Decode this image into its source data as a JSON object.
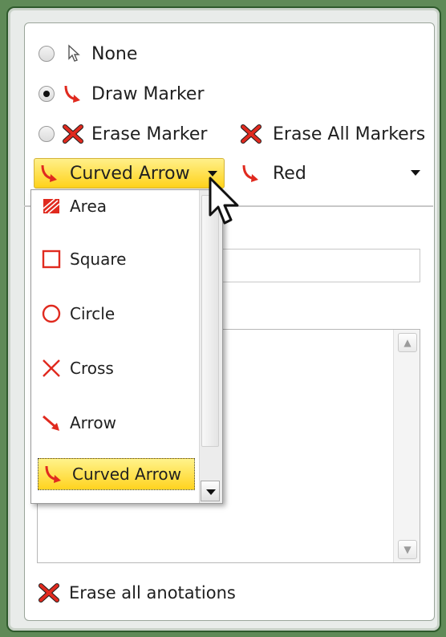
{
  "options": {
    "none_label": "None",
    "draw_marker_label": "Draw Marker",
    "erase_marker_label": "Erase Marker",
    "erase_all_markers_label": "Erase All Markers",
    "selected_mode": "Draw Marker"
  },
  "shape_select": {
    "value": "Curved Arrow",
    "items": [
      "Area",
      "Square",
      "Circle",
      "Cross",
      "Arrow",
      "Curved Arrow"
    ]
  },
  "color_select": {
    "value": "Red"
  },
  "footer": {
    "erase_all_annotations_label": "Erase all anotations"
  },
  "colors": {
    "marker_red": "#e02a1f",
    "highlight_yellow": "#ffd21a",
    "frame_green": "#5f8a57"
  },
  "icons": {
    "none": "cursor-arrow-icon",
    "draw_marker": "curved-arrow-icon",
    "erase_marker": "red-x-icon",
    "erase_all_markers": "red-x-icon",
    "shapes": [
      "area-icon",
      "square-icon",
      "circle-icon",
      "cross-icon",
      "arrow-icon",
      "curved-arrow-icon"
    ]
  }
}
